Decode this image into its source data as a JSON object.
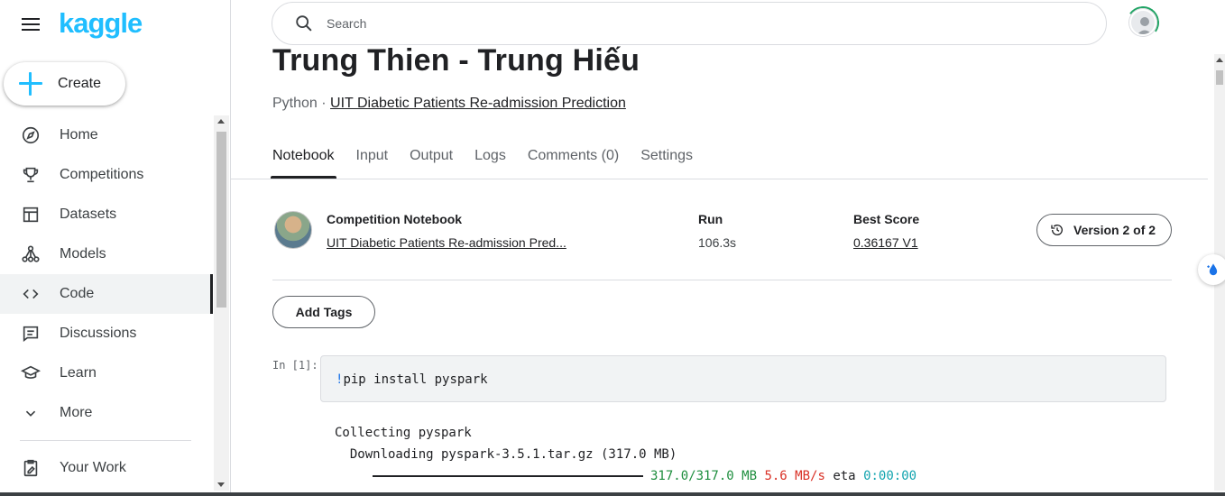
{
  "brand": {
    "logo_text": "kaggle"
  },
  "sidebar": {
    "create_label": "Create",
    "items": [
      {
        "label": "Home",
        "icon": "compass-icon"
      },
      {
        "label": "Competitions",
        "icon": "trophy-icon"
      },
      {
        "label": "Datasets",
        "icon": "table-icon"
      },
      {
        "label": "Models",
        "icon": "models-icon"
      },
      {
        "label": "Code",
        "icon": "code-icon",
        "active": true
      },
      {
        "label": "Discussions",
        "icon": "discussion-icon"
      },
      {
        "label": "Learn",
        "icon": "graduation-cap-icon"
      },
      {
        "label": "More",
        "icon": "chevron-down-icon"
      },
      {
        "label": "Your Work",
        "icon": "clipboard-edit-icon"
      }
    ]
  },
  "search": {
    "placeholder": "Search"
  },
  "notebook": {
    "title": "Trung Thien - Trung Hiếu",
    "language": "Python",
    "competition_link": "UIT Diabetic Patients Re-admission Prediction"
  },
  "tabs": [
    "Notebook",
    "Input",
    "Output",
    "Logs",
    "Comments (0)",
    "Settings"
  ],
  "meta": {
    "competition_label": "Competition Notebook",
    "competition_value": "UIT Diabetic Patients Re-admission Pred...",
    "run_label": "Run",
    "run_value": "106.3s",
    "score_label": "Best Score",
    "score_value": "0.36167 V1",
    "version_label": "Version 2 of 2"
  },
  "add_tags_label": "Add Tags",
  "cell": {
    "prompt": "In [1]:",
    "bang": "!",
    "code": "pip install pyspark"
  },
  "output": {
    "line1": "Collecting pyspark",
    "line2": "  Downloading pyspark-3.5.1.tar.gz (317.0 MB)",
    "progress": "317.0/317.0 MB",
    "speed": "5.6 MB/s",
    "eta_label": "eta",
    "eta": "0:00:00"
  },
  "colors": {
    "brand": "#20beff",
    "green": "#1e8e3e",
    "red": "#d93025",
    "cyan": "#12a4af"
  }
}
